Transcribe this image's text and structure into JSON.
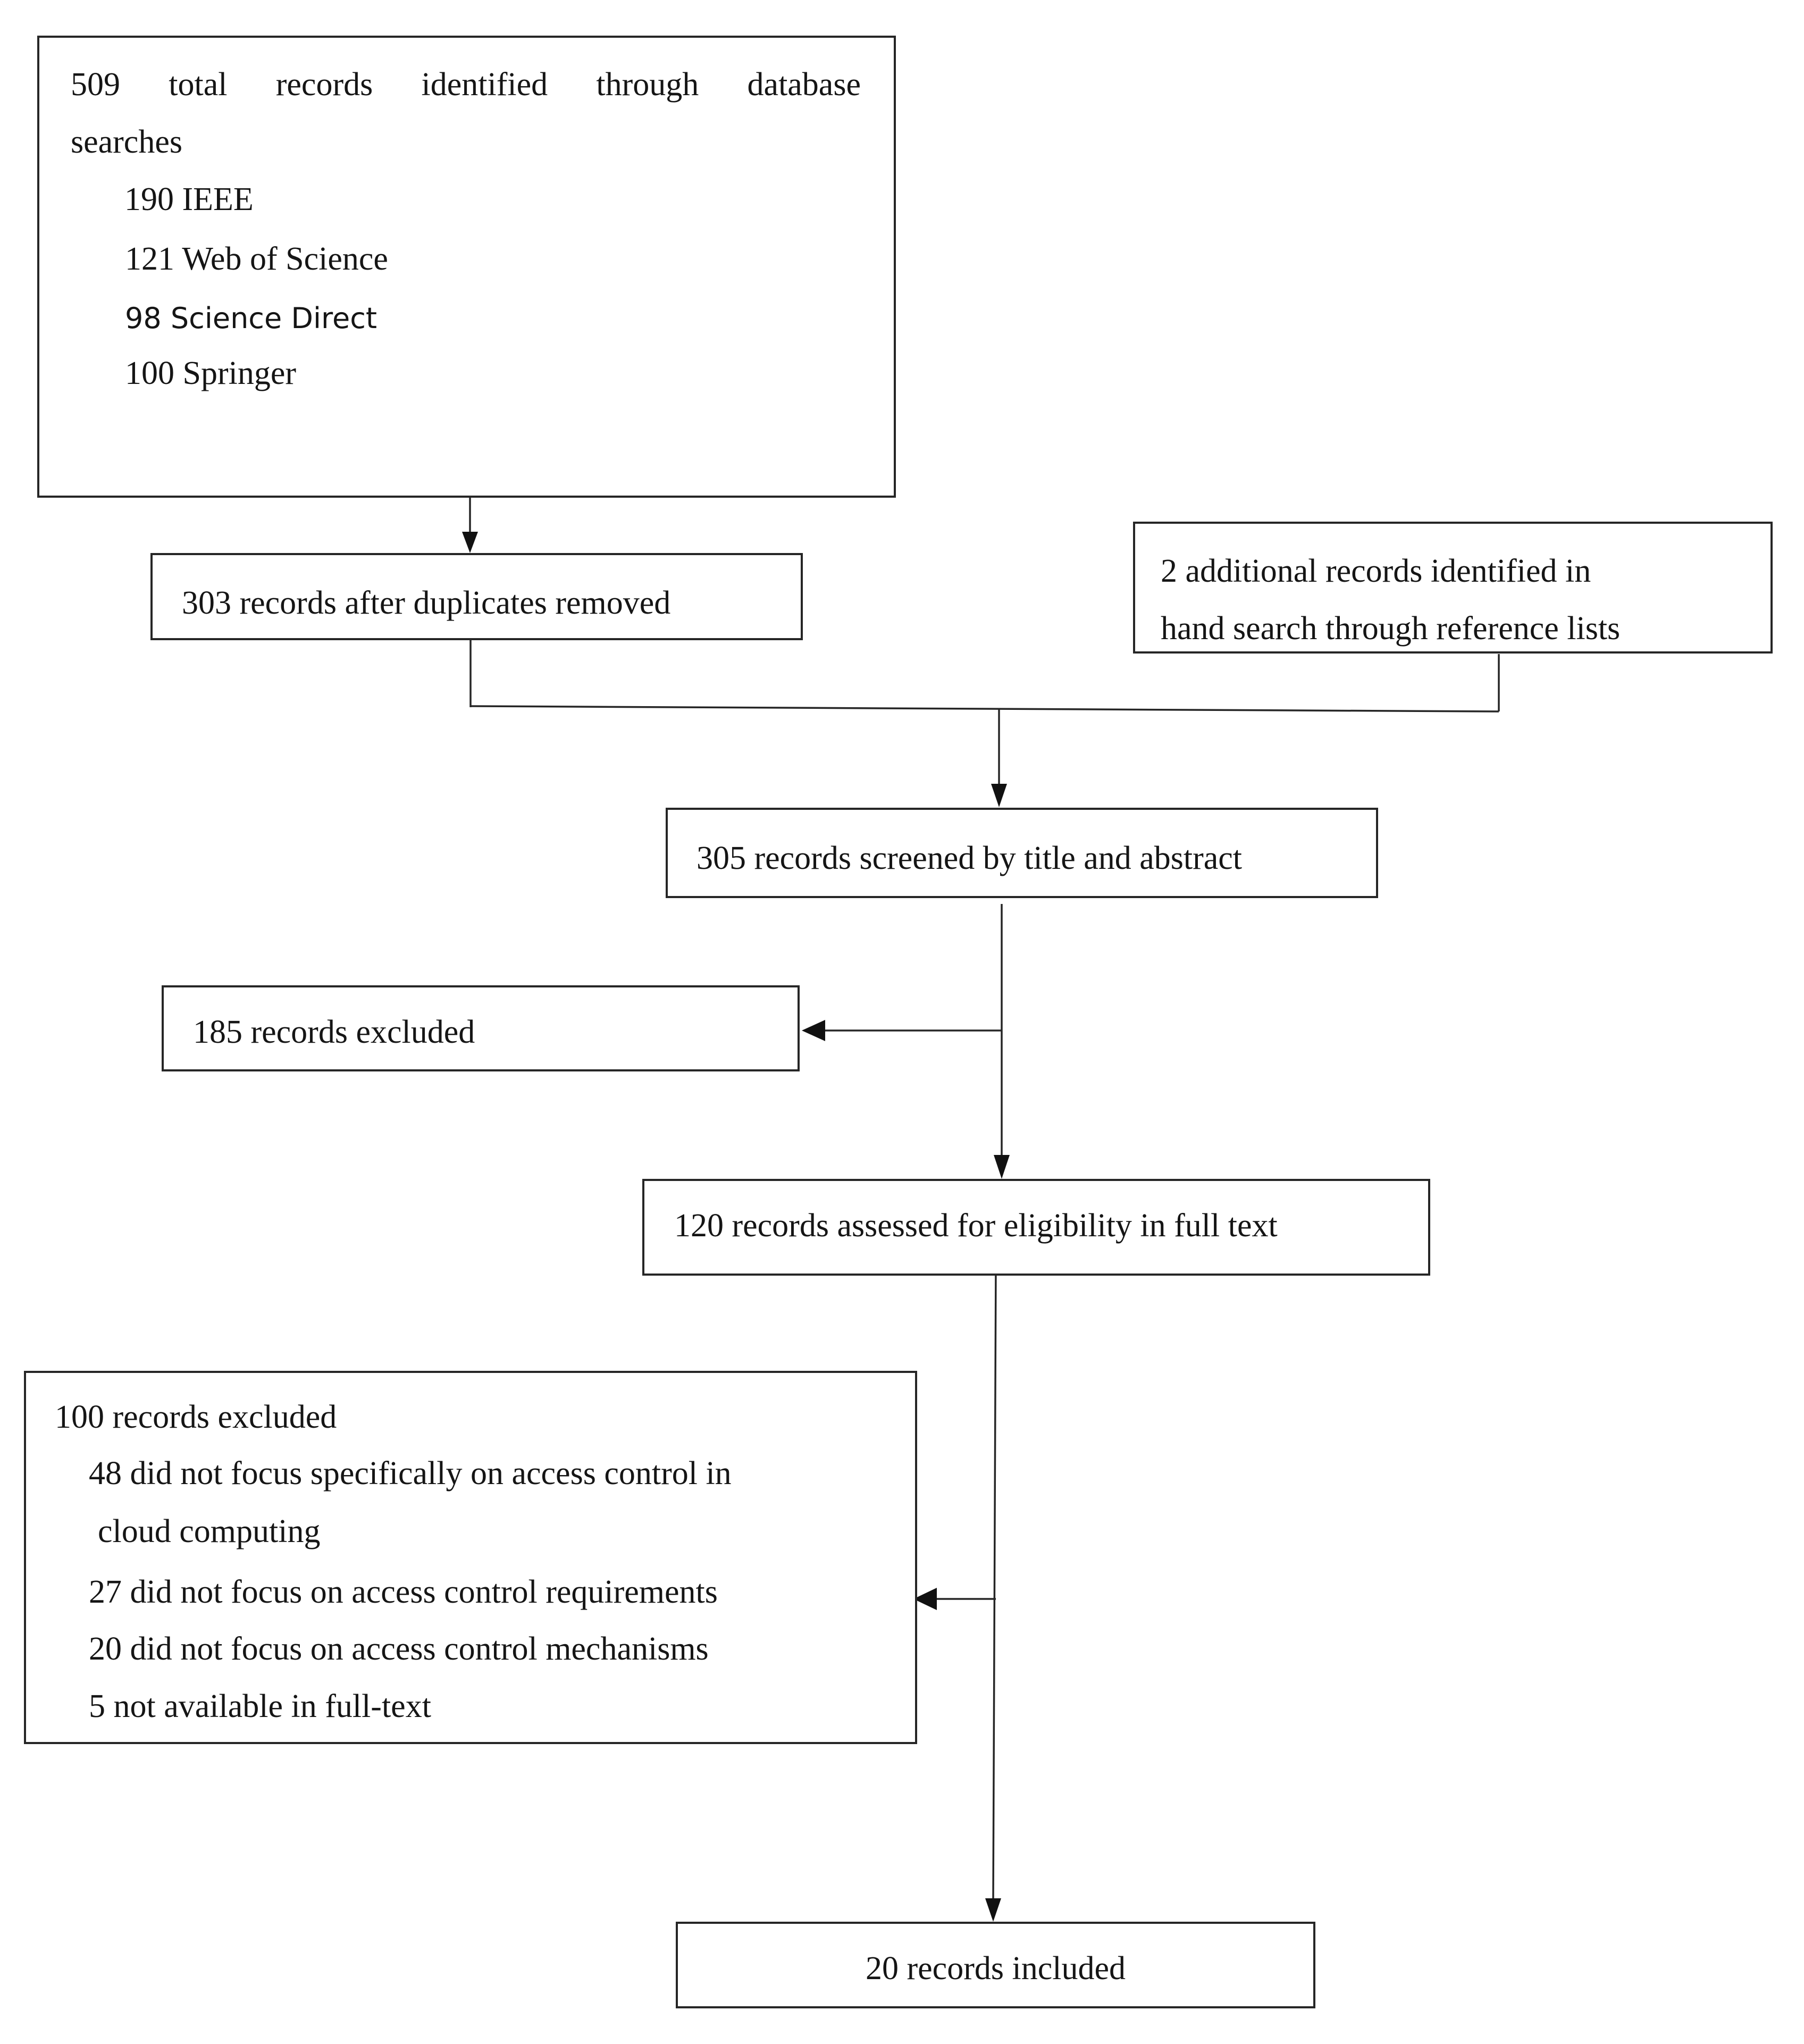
{
  "diagram": {
    "type": "PRISMA flow diagram",
    "identification": {
      "title_words": [
        "509",
        "total",
        "records",
        "identified",
        "through",
        "database"
      ],
      "title_line2": "searches",
      "sources": [
        {
          "count": 190,
          "label": "190 IEEE"
        },
        {
          "count": 121,
          "label": "121 Web of Science"
        },
        {
          "count": 98,
          "label": "98 Science Direct"
        },
        {
          "count": 100,
          "label": "100 Springer"
        }
      ],
      "total": 509
    },
    "after_duplicates": {
      "count": 303,
      "label": "303 records after duplicates removed"
    },
    "additional": {
      "count": 2,
      "line1": "2 additional records identified in",
      "line2": "hand search through reference lists"
    },
    "screened": {
      "count": 305,
      "label": "305 records screened by title and abstract"
    },
    "excluded_screening": {
      "count": 185,
      "label": "185 records excluded"
    },
    "eligibility": {
      "count": 120,
      "label": "120 records assessed for eligibility in full text"
    },
    "excluded_fulltext": {
      "count": 100,
      "label": "100 records excluded",
      "reasons": [
        {
          "count": 48,
          "line1": "48 did not focus specifically on access control in",
          "line2": "cloud computing"
        },
        {
          "count": 27,
          "label": "27 did not focus on access control requirements"
        },
        {
          "count": 20,
          "label": "20 did not focus on access control mechanisms"
        },
        {
          "count": 5,
          "label": "5 not available in full-text"
        }
      ]
    },
    "included": {
      "count": 20,
      "label": "20 records included"
    },
    "colors": {
      "line": "#262626",
      "text": "#151515",
      "background": "#ffffff"
    }
  }
}
